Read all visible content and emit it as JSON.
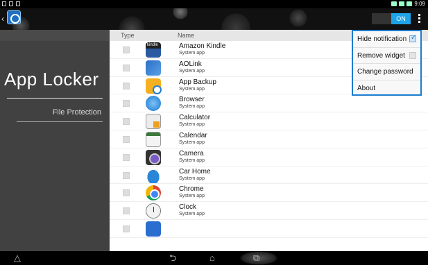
{
  "status_bar": {
    "time": "9:09"
  },
  "action_bar": {
    "toggle_label": "ON"
  },
  "sidebar": {
    "title": "App Locker",
    "item": "File Protection"
  },
  "list": {
    "headers": {
      "type": "Type",
      "name": "Name"
    },
    "rows": [
      {
        "name": "Amazon Kindle",
        "sub": "System app",
        "icon": "kindle-icon"
      },
      {
        "name": "AOLink",
        "sub": "System app",
        "icon": "aolink-icon"
      },
      {
        "name": "App Backup",
        "sub": "System app",
        "icon": "app-backup-icon"
      },
      {
        "name": "Browser",
        "sub": "System app",
        "icon": "browser-icon"
      },
      {
        "name": "Calculator",
        "sub": "System app",
        "icon": "calculator-icon"
      },
      {
        "name": "Calendar",
        "sub": "System app",
        "icon": "calendar-icon"
      },
      {
        "name": "Camera",
        "sub": "System app",
        "icon": "camera-icon"
      },
      {
        "name": "Car Home",
        "sub": "System app",
        "icon": "car-home-icon"
      },
      {
        "name": "Chrome",
        "sub": "System app",
        "icon": "chrome-icon"
      },
      {
        "name": "Clock",
        "sub": "System app",
        "icon": "clock-icon"
      }
    ]
  },
  "menu": {
    "hide_notification": "Hide notification",
    "remove_widget": "Remove widget",
    "change_password": "Change password",
    "about": "About"
  },
  "colors": {
    "accent": "#1b7ccf",
    "toggle_on": "#1fa3e8"
  }
}
